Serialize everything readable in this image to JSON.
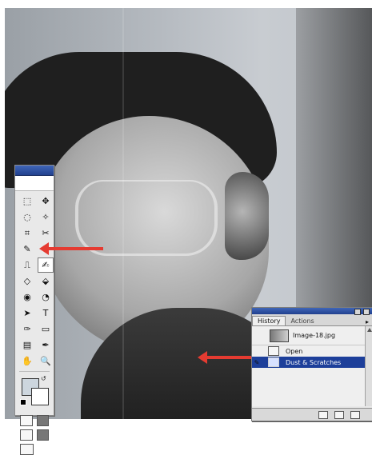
{
  "history_panel": {
    "tabs": [
      {
        "label": "History",
        "active": true
      },
      {
        "label": "Actions",
        "active": false
      }
    ],
    "menu_icon": "triangle-menu-icon",
    "snapshot": {
      "label": "Image-18.jpg"
    },
    "steps": [
      {
        "label": "Open",
        "selected": false
      },
      {
        "label": "Dust & Scratches",
        "selected": true
      }
    ],
    "footer_buttons": [
      "new-document-icon",
      "new-snapshot-icon",
      "delete-icon"
    ]
  },
  "toolbox": {
    "tools": [
      "marquee-icon",
      "move-icon",
      "lasso-icon",
      "magic-wand-icon",
      "crop-icon",
      "slice-icon",
      "healing-brush-icon",
      "brush-icon",
      "stamp-icon",
      "history-brush-icon",
      "eraser-icon",
      "paint-bucket-icon",
      "blur-icon",
      "dodge-icon",
      "path-selection-icon",
      "type-icon",
      "pen-icon",
      "rectangle-icon",
      "notes-icon",
      "eyedropper-icon",
      "hand-icon",
      "zoom-icon"
    ],
    "tool_glyphs": [
      "⬚",
      "✥",
      "◌",
      "✧",
      "⌗",
      "✂",
      "✎",
      "✎",
      "⎍",
      "✍",
      "◇",
      "⬙",
      "◉",
      "◔",
      "➤",
      "T",
      "✑",
      "▭",
      "▤",
      "✒",
      "✋",
      "🔍"
    ],
    "active_tool_index": 9,
    "foreground_color": "#cdd6de",
    "background_color": "#ffffff"
  },
  "annotations": {
    "arrow_color": "#e53b31"
  }
}
